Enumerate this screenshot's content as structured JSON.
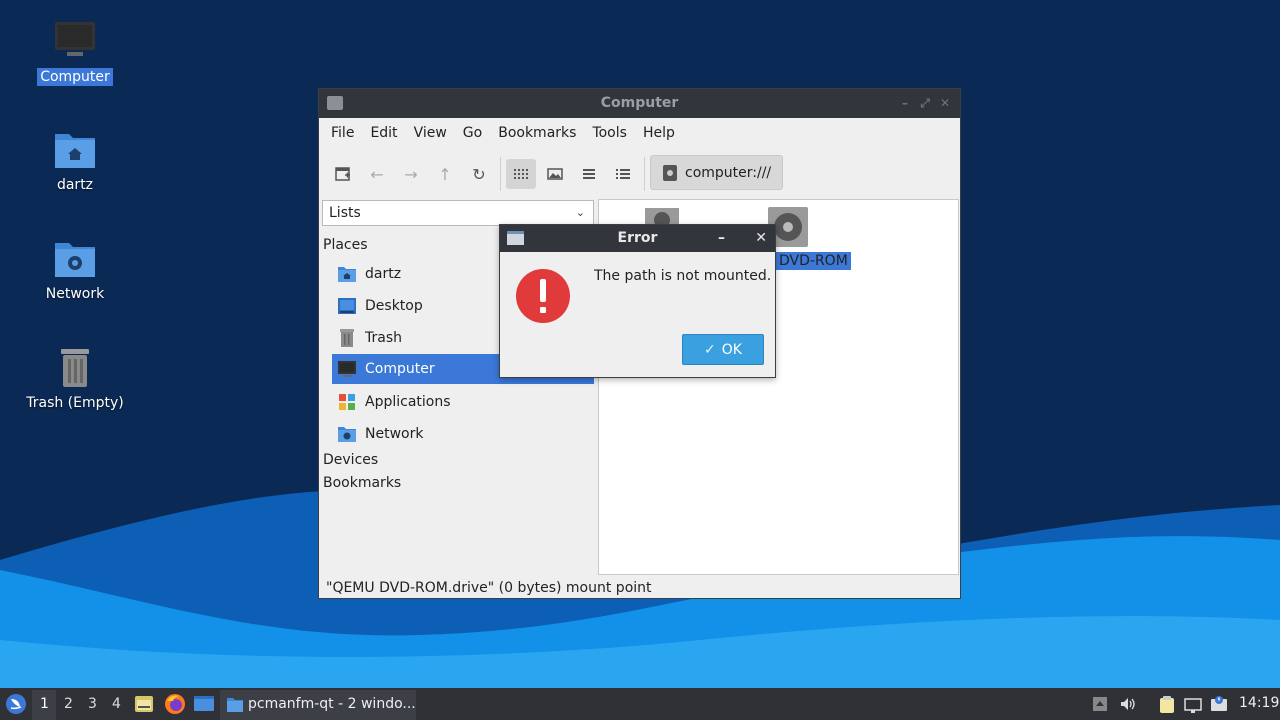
{
  "desktop": {
    "icons": [
      {
        "label": "Computer"
      },
      {
        "label": "dartz"
      },
      {
        "label": "Network"
      },
      {
        "label": "Trash (Empty)"
      }
    ]
  },
  "window": {
    "title": "Computer",
    "menu": [
      "File",
      "Edit",
      "View",
      "Go",
      "Bookmarks",
      "Tools",
      "Help"
    ],
    "path": "computer:///",
    "side_pane_mode": "Lists",
    "places_heading": "Places",
    "places": [
      {
        "label": "dartz",
        "icon": "home-folder-icon"
      },
      {
        "label": "Desktop",
        "icon": "desktop-icon"
      },
      {
        "label": "Trash",
        "icon": "trash-icon"
      },
      {
        "label": "Computer",
        "icon": "computer-icon",
        "selected": true
      },
      {
        "label": "Applications",
        "icon": "applications-icon"
      },
      {
        "label": "Network",
        "icon": "network-folder-icon"
      }
    ],
    "devices_heading": "Devices",
    "bookmarks_heading": "Bookmarks",
    "content_items": [
      {
        "label": "DVD-ROM"
      }
    ],
    "status": "\"QEMU DVD-ROM.drive\" (0 bytes) mount point"
  },
  "dialog": {
    "title": "Error",
    "message": "The path is not mounted.",
    "ok_label": "OK"
  },
  "taskbar": {
    "workspaces": [
      "1",
      "2",
      "3",
      "4"
    ],
    "active_workspace": "1",
    "task_label": "pcmanfm-qt - 2 windo...",
    "clock": "14:19"
  },
  "colors": {
    "desktop_bg": "#0a2a55",
    "selection": "#3b78d8",
    "ok_button": "#3aa0e0",
    "error_icon": "#e03a3a"
  }
}
